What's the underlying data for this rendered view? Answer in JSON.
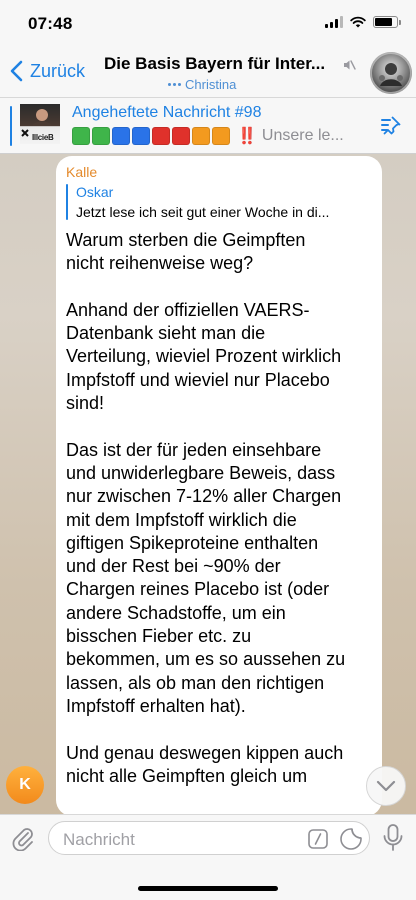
{
  "status_bar": {
    "time": "07:48",
    "battery_level": 0.8
  },
  "nav": {
    "back_label": "Zurück",
    "chat_title": "Die Basis Bayern für Inter...",
    "typing_user": "Christina",
    "muted_icon": "speaker-muted-icon",
    "avatar_icon": "group-avatar"
  },
  "pinned": {
    "title": "Angeheftete Nachricht #98",
    "thumbnail_text": "IllcieB",
    "squares": [
      "#3fb54a",
      "#3fb54a",
      "#2a73e8",
      "#2a73e8",
      "#e0312b",
      "#e0312b",
      "#f39a1f",
      "#f39a1f"
    ],
    "exclamation": "‼️",
    "preview_text": "Unsere le...",
    "list_icon": "pin-list-icon"
  },
  "message": {
    "sender": "Kalle",
    "sender_color": "#e48b2d",
    "reply_author": "Oskar",
    "reply_text": "Jetzt lese ich seit gut einer Woche in di...",
    "text": "Warum sterben die Geimpften\nnicht reihenweise weg?\n\nAnhand der offiziellen VAERS-\nDatenbank sieht man die\nVerteilung, wieviel Prozent wirklich\nImpfstoff und wieviel nur Placebo\nsind!\n\nDas ist der für jeden einsehbare\nund unwiderlegbare Beweis, dass\nnur zwischen 7-12% aller Chargen\nmit dem Impfstoff wirklich die\ngiftigen Spikeproteine enthalten\nund der Rest bei ~90% der\nChargen reines Placebo ist (oder\nandere Schadstoffe, um ein\nbisschen Fieber etc. zu\nbekommen, um es so aussehen zu\nlassen, als ob man den richtigen\nImpfstoff erhalten hat).\n\nUnd genau deswegen kippen auch\nnicht alle Geimpften gleich um"
  },
  "avatar": {
    "initial": "K"
  },
  "input": {
    "placeholder": "Nachricht"
  },
  "colors": {
    "accent": "#1f82e3",
    "sender_orange": "#e48b2d",
    "alert_red": "#e0261f"
  }
}
